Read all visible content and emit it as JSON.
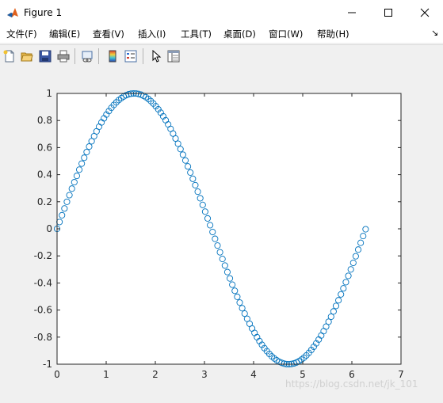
{
  "window": {
    "title": "Figure 1"
  },
  "menu": {
    "items": [
      {
        "label": "文件(F)"
      },
      {
        "label": "编辑(E)"
      },
      {
        "label": "查看(V)"
      },
      {
        "label": "插入(I)"
      },
      {
        "label": "工具(T)"
      },
      {
        "label": "桌面(D)"
      },
      {
        "label": "窗口(W)"
      },
      {
        "label": "帮助(H)"
      }
    ],
    "overflow_icon": "arrow-icon"
  },
  "toolbar": {
    "buttons": [
      "new-figure-icon",
      "open-file-icon",
      "save-icon",
      "print-icon",
      "link-plot-icon",
      "colorbar-icon",
      "legend-icon",
      "pointer-icon",
      "property-editor-icon"
    ]
  },
  "watermark": "https://blog.csdn.net/jk_101",
  "colors": {
    "marker": "#0072bd",
    "axes": "#262626",
    "plot_bg": "#ffffff",
    "figure_bg": "#f0f0f0"
  },
  "chart_data": {
    "type": "scatter",
    "marker": "circle",
    "function": "sin(x)",
    "x_range": [
      0,
      6.28
    ],
    "n_points": 126,
    "xlim": [
      0,
      7
    ],
    "ylim": [
      -1,
      1
    ],
    "xticks": [
      "0",
      "1",
      "2",
      "3",
      "4",
      "5",
      "6",
      "7"
    ],
    "yticks": [
      "1",
      "0.8",
      "0.6",
      "0.4",
      "0.2",
      "0",
      "-0.2",
      "-0.4",
      "-0.6",
      "-0.8",
      "-1"
    ],
    "title": "",
    "xlabel": "",
    "ylabel": "",
    "grid": false
  }
}
